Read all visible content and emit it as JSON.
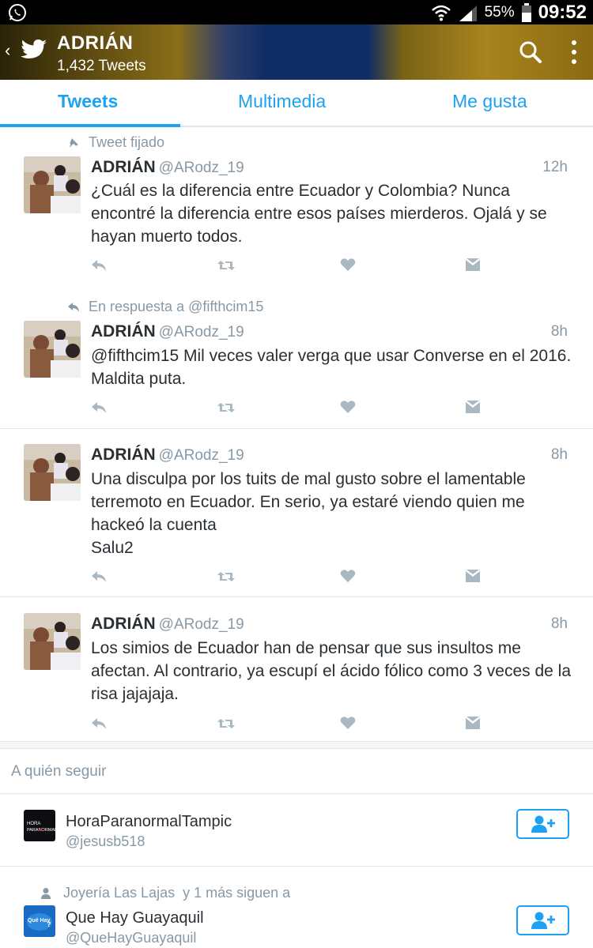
{
  "status_bar": {
    "battery": "55%",
    "time": "09:52"
  },
  "header": {
    "name": "ADRIÁN",
    "tweet_count": "1,432 Tweets"
  },
  "tabs": [
    {
      "label": "Tweets"
    },
    {
      "label": "Multimedia"
    },
    {
      "label": "Me gusta"
    }
  ],
  "tweets": [
    {
      "context": "Tweet fijado",
      "name": "ADRIÁN",
      "handle": "@ARodz_19",
      "time": "12h",
      "text": "¿Cuál es la diferencia entre Ecuador y Colombia? Nunca encontré la diferencia entre esos países mierderos. Ojalá y se hayan muerto todos."
    },
    {
      "context": "En respuesta a @fifthcim15",
      "name": "ADRIÁN",
      "handle": "@ARodz_19",
      "time": "8h",
      "text": "@fifthcim15 Mil veces valer verga que usar Converse en el 2016. Maldita puta."
    },
    {
      "name": "ADRIÁN",
      "handle": "@ARodz_19",
      "time": "8h",
      "text": "Una disculpa por los tuits de mal gusto sobre el lamentable terremoto en Ecuador. En serio, ya estaré viendo quien me hackeó la cuenta\nSalu2"
    },
    {
      "name": "ADRIÁN",
      "handle": "@ARodz_19",
      "time": "8h",
      "text": "Los simios de Ecuador han de pensar que sus insultos me afectan. Al contrario, ya escupí el ácido fólico como 3 veces de la risa jajajaja."
    }
  ],
  "who_to_follow": {
    "title": "A quién seguir",
    "accounts": [
      {
        "name": "HoraParanormalTampic",
        "handle": "@jesusb518",
        "avatar_text": "HORA PARANORMAL"
      },
      {
        "context_name": "Joyería Las Lajas",
        "context_rest": "y 1 más siguen a",
        "name": "Que Hay Guayaquil",
        "handle": "@QueHayGuayaquil",
        "avatar_text": "Qué Hay"
      }
    ]
  },
  "colors": {
    "accent": "#1da1f2",
    "muted": "#8899a6",
    "text": "#292f33"
  }
}
